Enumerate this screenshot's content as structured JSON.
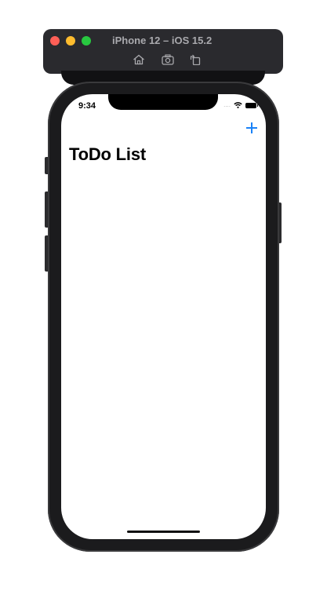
{
  "simulator": {
    "title": "iPhone 12 – iOS 15.2",
    "traffic_lights": {
      "close": "#ff5f57",
      "minimize": "#febc2e",
      "zoom": "#28c840"
    },
    "toolbar_buttons": [
      "home-icon",
      "screenshot-icon",
      "rotate-icon"
    ]
  },
  "status_bar": {
    "time": "9:34",
    "signal": "....",
    "icons": [
      "wifi-icon",
      "battery-icon"
    ]
  },
  "nav_bar": {
    "title": "ToDo List",
    "add_button": "plus-icon",
    "accent_color": "#1a82f7"
  }
}
